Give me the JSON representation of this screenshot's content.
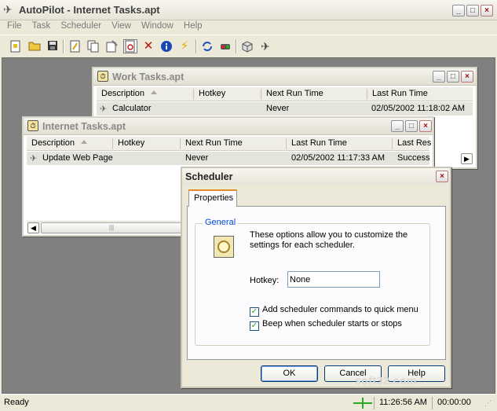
{
  "app": {
    "title": "AutoPilot - Internet Tasks.apt"
  },
  "menu": [
    "File",
    "Task",
    "Scheduler",
    "View",
    "Window",
    "Help"
  ],
  "toolbar_icons": [
    "new-icon",
    "open-icon",
    "save-icon",
    "edit-icon",
    "copy-icon",
    "properties-icon",
    "scheduler-icon",
    "delete-icon",
    "info-icon",
    "run-icon",
    "refresh-icon",
    "traffic-light-icon",
    "cube-icon",
    "plane-icon"
  ],
  "work_window": {
    "title": "Work Tasks.apt",
    "columns": [
      "Description",
      "Hotkey",
      "Next Run Time",
      "Last Run Time"
    ],
    "rows": [
      {
        "description": "Calculator",
        "hotkey": "",
        "next_run": "Never",
        "last_run": "02/05/2002 11:18:02 AM"
      }
    ]
  },
  "internet_window": {
    "title": "Internet Tasks.apt",
    "columns": [
      "Description",
      "Hotkey",
      "Next Run Time",
      "Last Run Time",
      "Last Res"
    ],
    "rows": [
      {
        "description": "Update Web Page",
        "hotkey": "",
        "next_run": "Never",
        "last_run": "02/05/2002 11:17:33 AM",
        "result": "Success"
      }
    ]
  },
  "dialog": {
    "title": "Scheduler",
    "tab": "Properties",
    "group": "General",
    "description": "These options allow you to customize the settings for each scheduler.",
    "hotkey_label": "Hotkey:",
    "hotkey_value": "None",
    "checkbox_quick_menu": "Add scheduler commands to quick menu",
    "checkbox_beep": "Beep when scheduler starts or stops",
    "buttons": {
      "ok": "OK",
      "cancel": "Cancel",
      "help": "Help"
    }
  },
  "status": {
    "text": "Ready",
    "time": "11:26:56 AM",
    "timer": "00:00:00"
  },
  "watermark": "soft32.com",
  "colors": {
    "accent_tab": "#e68b2c",
    "group_label": "#0046d5",
    "mdi_background": "#808080"
  }
}
